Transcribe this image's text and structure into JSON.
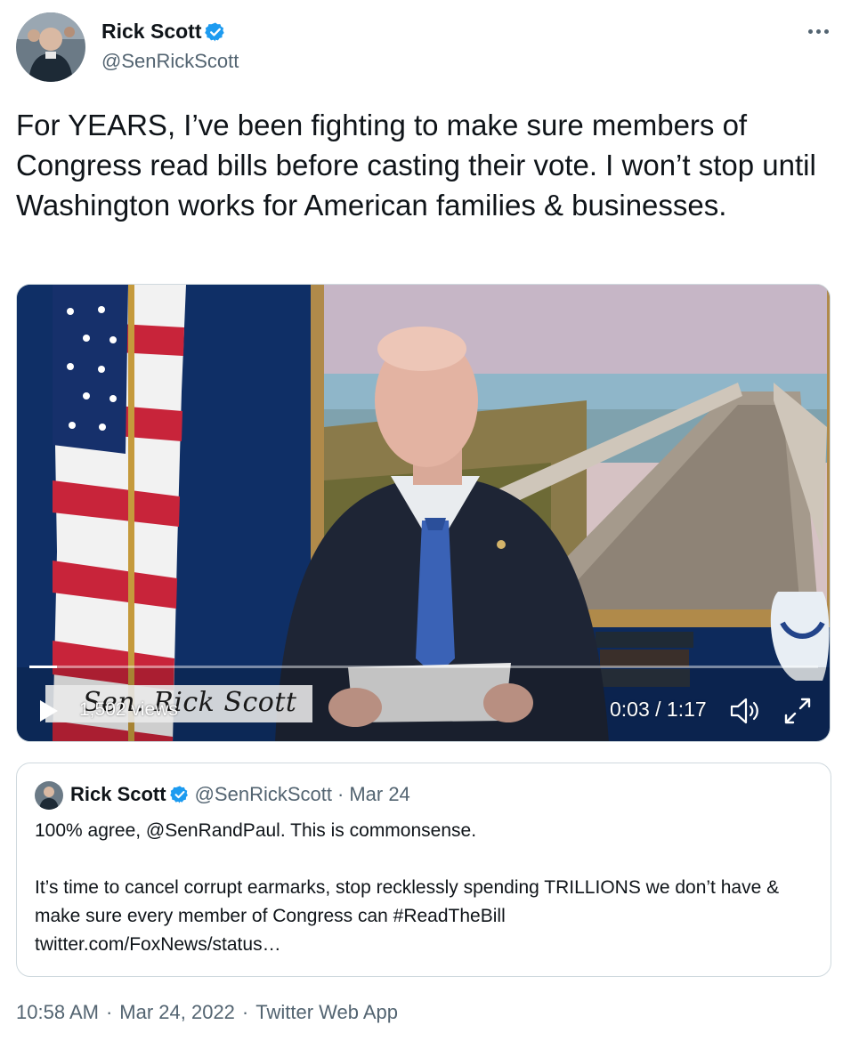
{
  "author": {
    "display_name": "Rick Scott",
    "handle": "@SenRickScott",
    "avatar_icon": "profile-photo",
    "verified_color": "#1d9bf0"
  },
  "tweet": {
    "text": "For YEARS, I’ve been fighting to make sure members of Congress read bills before casting their vote. I won’t stop until Washington works for American families & businesses."
  },
  "video": {
    "lower_third": "Sen. Rick Scott",
    "views": "1,502 views",
    "time": "0:03 / 1:17",
    "progress_fraction": 0.035
  },
  "quote": {
    "display_name": "Rick Scott",
    "handle": "@SenRickScott",
    "separator": "·",
    "date": "Mar 24",
    "line1": "100% agree, @SenRandPaul. This is commonsense.",
    "line2": "It’s time to cancel corrupt earmarks, stop recklessly spending TRILLIONS we don’t have & make sure every member of Congress can #ReadTheBill",
    "line3": "twitter.com/FoxNews/status…"
  },
  "meta": {
    "time": "10:58 AM",
    "date": "Mar 24, 2022",
    "source": "Twitter Web App",
    "separator": "·"
  }
}
